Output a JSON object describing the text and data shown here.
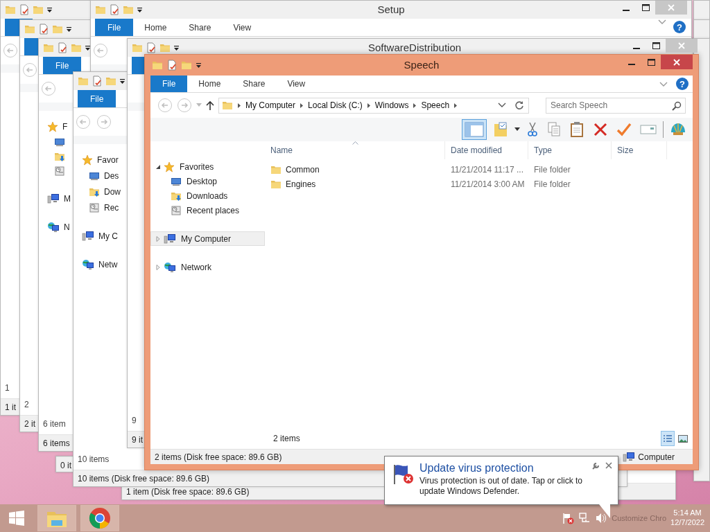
{
  "background_windows": [
    {
      "content_count": "1",
      "status": "1 it"
    },
    {
      "content_count": "2",
      "status": "2 it"
    },
    {
      "ribbon_tabs": [
        {
          "label": "File",
          "selected": true
        }
      ],
      "nav_items": [
        {
          "kind": "favorites",
          "label": "F"
        },
        {
          "kind": "desktop"
        },
        {
          "kind": "downloads"
        },
        {
          "kind": "recent"
        },
        {
          "kind": "computer",
          "label": "M"
        },
        {
          "kind": "network",
          "label": "N"
        }
      ],
      "content_count": "6 item",
      "status": "6 items"
    },
    {
      "status": "0 it"
    },
    {
      "title": "Setup",
      "ribbon_tabs": [
        {
          "label": "File",
          "selected": true
        },
        {
          "label": "Home",
          "selected": false
        },
        {
          "label": "Share",
          "selected": false
        },
        {
          "label": "View",
          "selected": false
        }
      ],
      "help_label": "?"
    },
    {
      "status": "1 item (Disk free space: 89.6 GB)"
    },
    {
      "ribbon_tabs": [
        {
          "label": "File",
          "selected": true
        }
      ],
      "nav_items": [
        {
          "kind": "favorites",
          "label": "Favor"
        },
        {
          "kind": "desktop",
          "label": "Des"
        },
        {
          "kind": "downloads",
          "label": "Dow"
        },
        {
          "kind": "recent",
          "label": "Rec"
        },
        {
          "kind": "computer",
          "label": "My C"
        },
        {
          "kind": "network",
          "label": "Netw"
        }
      ],
      "content_count": "10 items",
      "status": "10 items (Disk free space: 89.6 GB)"
    },
    {
      "title": "SoftwareDistribution",
      "content_count": "9",
      "status": "9 it"
    }
  ],
  "window": {
    "title": "Speech",
    "help_label": "?",
    "ribbon_tabs": [
      {
        "label": "File",
        "selected": true
      },
      {
        "label": "Home",
        "selected": false
      },
      {
        "label": "Share",
        "selected": false
      },
      {
        "label": "View",
        "selected": false
      }
    ],
    "breadcrumbs": [
      "My Computer",
      "Local Disk (C:)",
      "Windows",
      "Speech"
    ],
    "search": {
      "placeholder": "Search Speech"
    },
    "nav_tree": [
      {
        "kind": "favorites",
        "label": "Favorites",
        "expanded": true,
        "selected": false,
        "children": [
          {
            "kind": "desktop",
            "label": "Desktop",
            "selected": false
          },
          {
            "kind": "downloads",
            "label": "Downloads",
            "selected": false
          },
          {
            "kind": "recent",
            "label": "Recent places",
            "selected": false
          }
        ]
      },
      {
        "kind": "computer",
        "label": "My Computer",
        "expanded": false,
        "selected": true
      },
      {
        "kind": "network",
        "label": "Network",
        "expanded": false,
        "selected": false
      }
    ],
    "columns": [
      {
        "label": "Name",
        "sorted": true
      },
      {
        "label": "Date modified",
        "sorted": false
      },
      {
        "label": "Type",
        "sorted": false
      },
      {
        "label": "Size",
        "sorted": false
      }
    ],
    "rows": [
      {
        "name": "Common",
        "date_modified": "11/21/2014 11:17 ...",
        "type": "File folder"
      },
      {
        "name": "Engines",
        "date_modified": "11/21/2014 3:00 AM",
        "type": "File folder"
      }
    ],
    "item_count": "2 items",
    "views": [
      {
        "kind": "details",
        "selected": true
      },
      {
        "kind": "thumbnails",
        "selected": false
      }
    ],
    "status_bar": {
      "text": "2 items (Disk free space: 89.6 GB)",
      "zone": "Computer"
    }
  },
  "notification": {
    "title": "Update virus protection",
    "body": "Virus protection is out of date. Tap or click to update Windows Defender."
  },
  "taskbar": {
    "buttons": [
      {
        "kind": "explorer"
      },
      {
        "kind": "chrome"
      }
    ],
    "tooltip": "Customize Chro",
    "time": "5:14 AM",
    "date": "12/7/2022"
  }
}
